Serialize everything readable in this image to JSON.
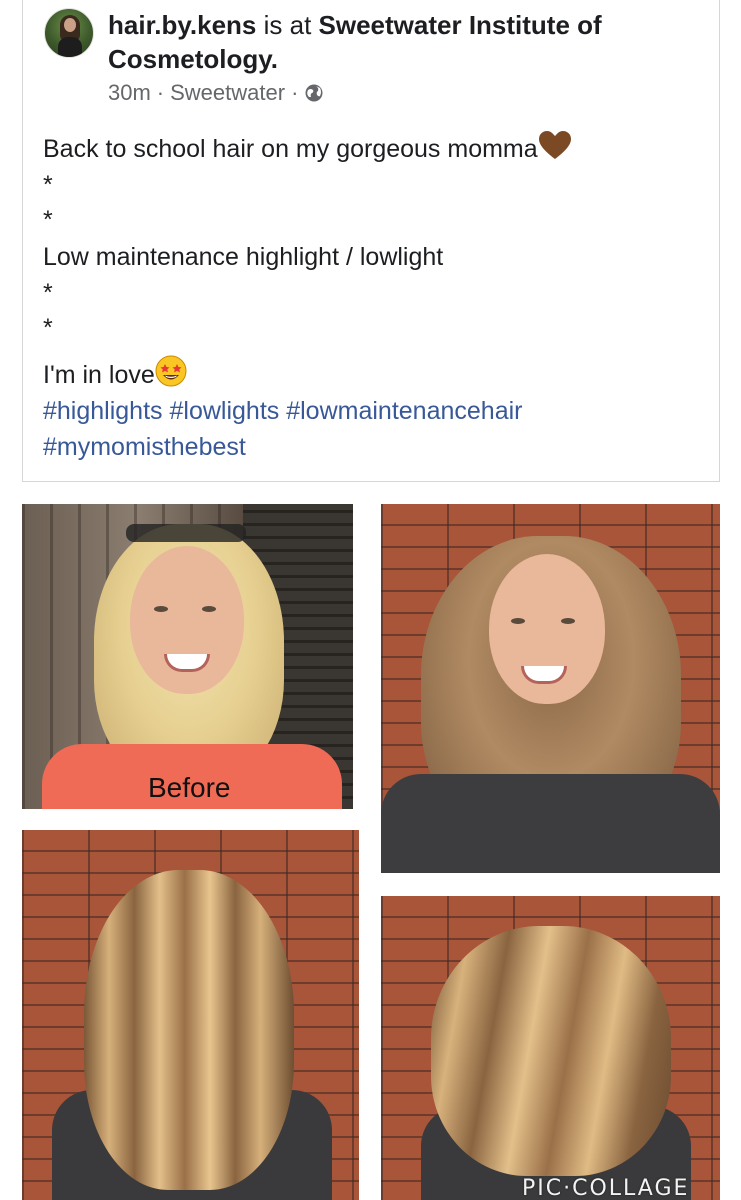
{
  "post": {
    "author": "hair.by.kens",
    "checkin_connector": "is at",
    "place": "Sweetwater Institute of Cosmetology.",
    "time": "30m",
    "location": "Sweetwater",
    "separator": "·",
    "privacy_icon": "globe-icon",
    "lines": [
      "Back to school hair on my gorgeous momma",
      "*",
      "*",
      "Low maintenance highlight / lowlight",
      "*",
      "*",
      "I'm in love"
    ],
    "emoji_heart": "brown-heart-emoji",
    "emoji_face": "star-struck-emoji",
    "hashtags": [
      "#highlights",
      "#lowlights",
      "#lowmaintenancehair",
      "#mymomisthebest"
    ]
  },
  "photos": {
    "before_label": "Before",
    "watermark": "PIC·COLLAGE"
  },
  "colors": {
    "link": "#385898",
    "secondary_text": "#65676b",
    "brick": "#a9553a"
  }
}
